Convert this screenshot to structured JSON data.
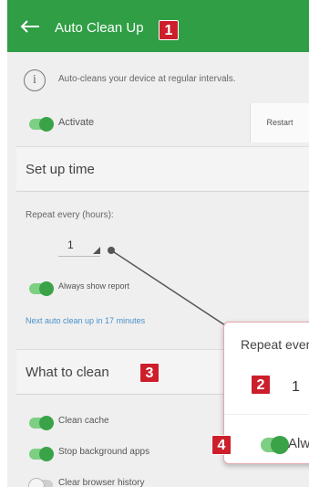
{
  "appbar": {
    "title": "Auto Clean Up"
  },
  "badges": {
    "b1": "1",
    "b2": "2",
    "b3": "3",
    "b4": "4"
  },
  "info": {
    "text": "Auto-cleans your device at regular intervals."
  },
  "activate": {
    "label": "Activate",
    "restart_label": "Restart"
  },
  "setup": {
    "title": "Set up time",
    "repeat_label": "Repeat every (hours):",
    "repeat_value": "1",
    "always_show_label": "Always show report",
    "next_link": "Next auto clean up in 17 minutes"
  },
  "clean": {
    "title": "What to clean",
    "items": [
      {
        "label": "Clean cache",
        "on": true
      },
      {
        "label": "Stop background apps",
        "on": true
      },
      {
        "label": "Clear browser history",
        "on": false
      }
    ]
  },
  "popup": {
    "title": "Repeat every",
    "value": "1",
    "toggle_label": "Alw"
  },
  "colors": {
    "appbar": "#2f9e45",
    "toggle": "#3aa347",
    "badge": "#cc1f2b",
    "link": "#4a90c8"
  }
}
